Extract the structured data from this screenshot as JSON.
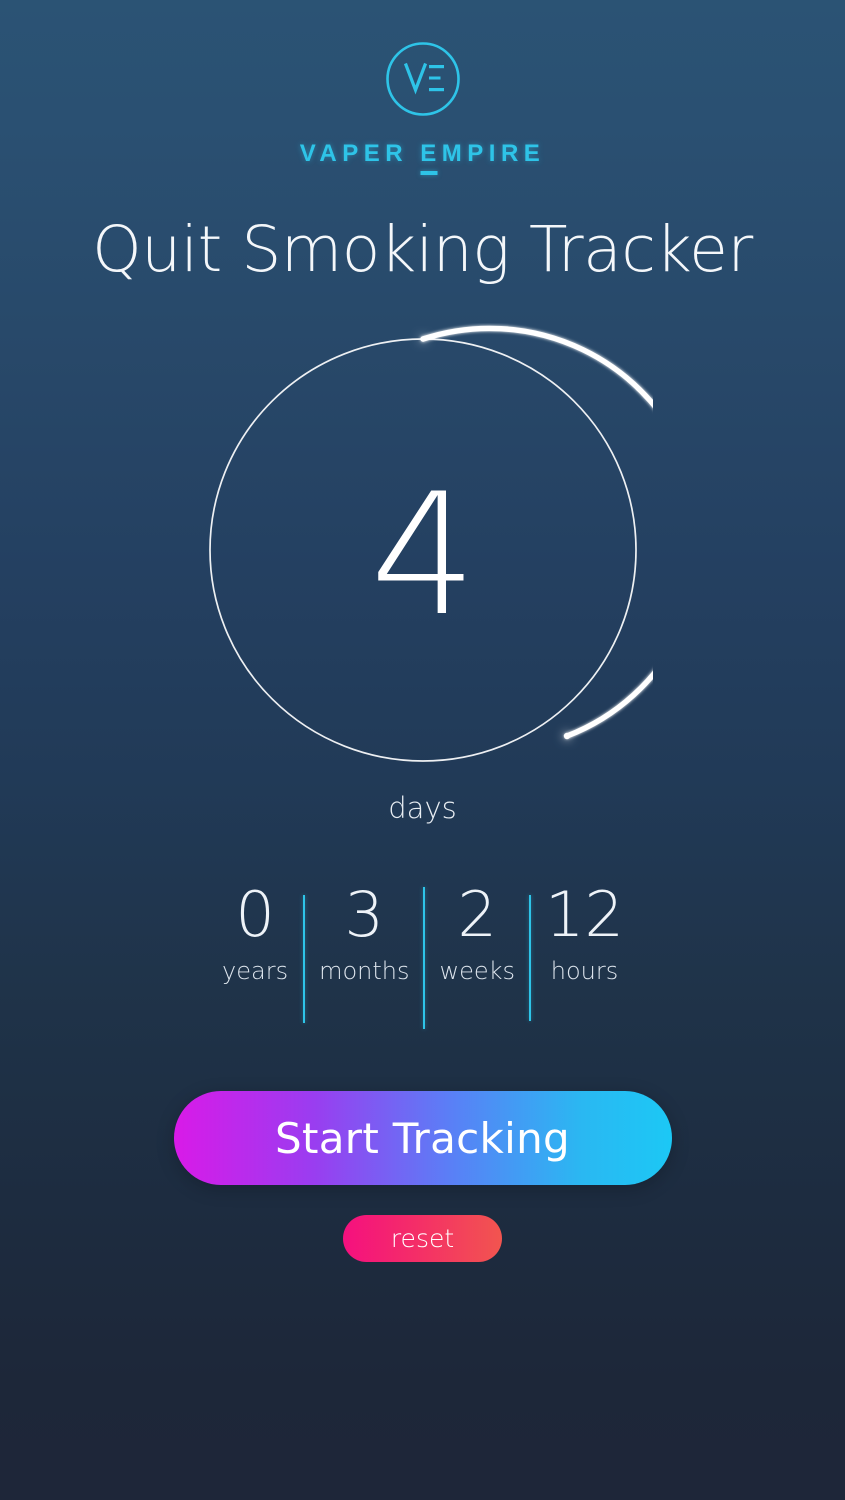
{
  "brand": {
    "logo_icon": "ve-monogram-circle-icon",
    "monogram": "VE",
    "wordmark": "VAPER EMPIRE",
    "accent_color": "#2ec4e8"
  },
  "header": {
    "title": "Quit Smoking Tracker"
  },
  "tracker": {
    "value": "4",
    "unit": "days",
    "progress_percent": 37,
    "ring_track_color": "#ffffff",
    "ring_progress_color": "#ffffff"
  },
  "stats": {
    "items": [
      {
        "value": "0",
        "label": "years"
      },
      {
        "value": "3",
        "label": "months"
      },
      {
        "value": "2",
        "label": "weeks"
      },
      {
        "value": "12",
        "label": "hours"
      }
    ]
  },
  "actions": {
    "start_label": "Start Tracking",
    "start_gradient_from": "#d91ae8",
    "start_gradient_to": "#1cc8f5",
    "reset_label": "reset",
    "reset_gradient_from": "#f5107f",
    "reset_gradient_to": "#f2554f"
  },
  "background": {
    "gradient_from": "#2b5374",
    "gradient_to": "#1e2639"
  }
}
